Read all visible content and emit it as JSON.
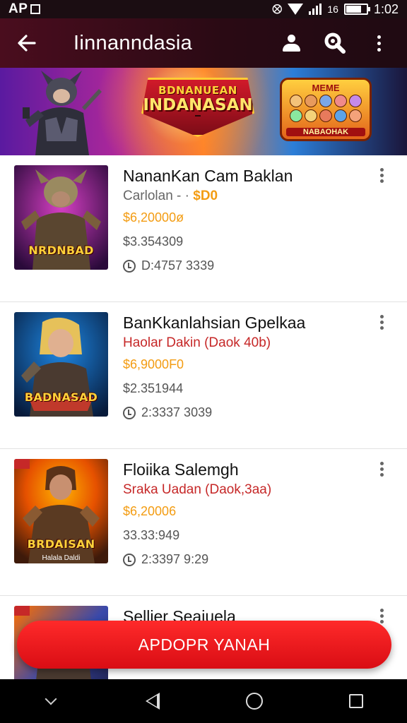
{
  "status_bar": {
    "left_text": "AP",
    "time": "1:02",
    "battery_text": "16"
  },
  "app_bar": {
    "title": "Iinnanndasia",
    "back_icon": "arrow-left-icon",
    "actions": [
      "person-icon",
      "search-icon",
      "more-vert-icon"
    ]
  },
  "banner": {
    "logo_line1": "BDNANUEAN",
    "logo_line2": "INDANASAN",
    "logo_line3": "",
    "group_title": "MEME",
    "group_label": "NABAOHAK"
  },
  "items": [
    {
      "title": "NananKan Cam Baklan",
      "subtitle": "Carlolan - ·",
      "subtitle_price": "$D0",
      "price": "$6,20000ø",
      "meta": "$3.354309",
      "time": "D:4757 3339",
      "thumb_label": "NRDNBAD",
      "thumb_sub": "",
      "thumb_colors": [
        "#7b1fa2",
        "#d63fc4",
        "#2a0a3a"
      ]
    },
    {
      "title": "BanKkanlahsian Gpelkaa",
      "subtitle": "Haolar Dakin (Daok 40b)",
      "subtitle_price": "",
      "price": "$6,9000F0",
      "meta": "$2.351944",
      "time": "2:3337 3039",
      "thumb_label": "BADNASAD",
      "thumb_sub": "",
      "thumb_colors": [
        "#0d47a1",
        "#1e88e5",
        "#071a3a"
      ]
    },
    {
      "title": "Floiika Salemgh",
      "subtitle": "Sraka Uadan (Daok,3aa)",
      "subtitle_price": "",
      "price": "$6,20006",
      "meta": "33.33:949",
      "time": "2:3397 9:29",
      "thumb_label": "BRDAISAN",
      "thumb_sub": "Halala Daldi",
      "thumb_colors": [
        "#e65100",
        "#ffb300",
        "#3e1a0a"
      ]
    },
    {
      "title": "Sellier Seaiuela",
      "subtitle": "",
      "subtitle_price": "",
      "price": "",
      "meta": "",
      "time": "",
      "thumb_label": "",
      "thumb_sub": "",
      "thumb_colors": [
        "#ff6f00",
        "#3949ab",
        "#1a1a3a"
      ]
    }
  ],
  "cta": {
    "label": "APDOPR YANAH"
  },
  "nav_bar": {
    "icons": [
      "chevron-down-icon",
      "back-triangle-icon",
      "home-circle-icon",
      "recents-square-icon"
    ]
  }
}
